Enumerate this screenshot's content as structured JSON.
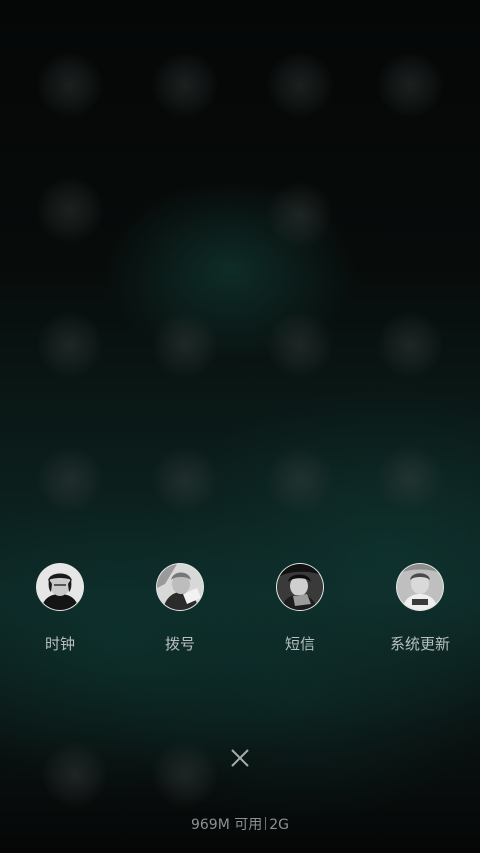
{
  "recent_apps": [
    {
      "label": "时钟",
      "icon": "clock-app-icon"
    },
    {
      "label": "拨号",
      "icon": "dialer-app-icon"
    },
    {
      "label": "短信",
      "icon": "messages-app-icon"
    },
    {
      "label": "系统更新",
      "icon": "system-update-app-icon"
    }
  ],
  "close_button": {
    "icon": "close-x-icon"
  },
  "memory": {
    "available": "969M 可用",
    "total": "2G"
  },
  "colors": {
    "accent_teal": "#0d2624",
    "label_text": "#b9bfbe",
    "memory_text": "#8c9291"
  }
}
